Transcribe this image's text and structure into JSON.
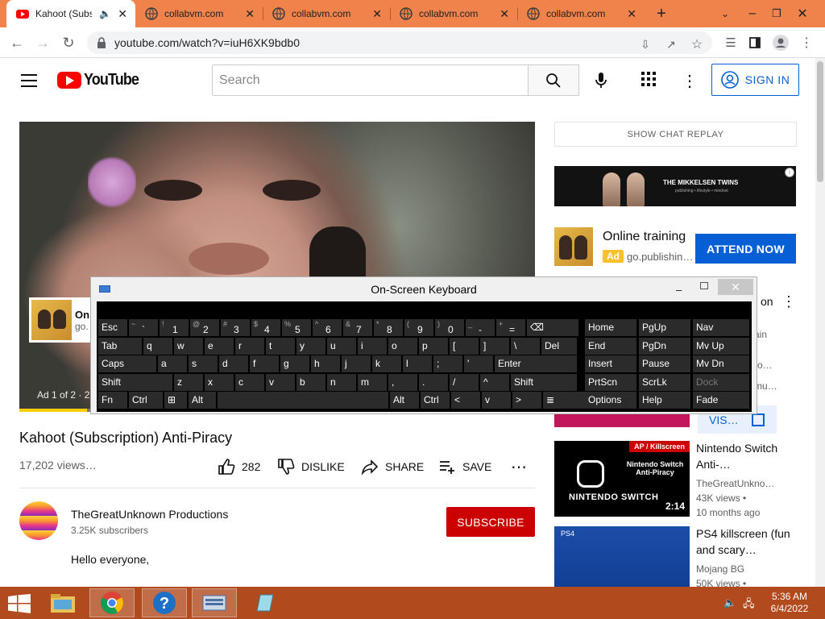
{
  "browser": {
    "tabs": [
      {
        "title": "Kahoot (Subs",
        "active": true,
        "icon": "youtube-icon",
        "audio": true
      },
      {
        "title": "collabvm.com",
        "active": false,
        "icon": "globe-icon"
      },
      {
        "title": "collabvm.com",
        "active": false,
        "icon": "globe-icon"
      },
      {
        "title": "collabvm.com",
        "active": false,
        "icon": "globe-icon"
      },
      {
        "title": "collabvm.com",
        "active": false,
        "icon": "globe-icon"
      }
    ],
    "url": "youtube.com/watch?v=iuH6XK9bdb0",
    "colors": {
      "tabstrip": "#f0834b"
    }
  },
  "youtube": {
    "logo_text": "YouTube",
    "search_placeholder": "Search",
    "signin_label": "SIGN IN",
    "video": {
      "ad_card_title": "On",
      "ad_card_url": "go.",
      "ad_label": "Ad 1 of 2 · 2"
    },
    "title": "Kahoot (Subscription) Anti-Piracy",
    "views": "17,202 views…",
    "actions": {
      "like_count": "282",
      "dislike_label": "DISLIKE",
      "share_label": "SHARE",
      "save_label": "SAVE"
    },
    "channel": {
      "name": "TheGreatUnknown Productions",
      "subscribers": "3.25K subscribers",
      "subscribe_label": "SUBSCRIBE"
    },
    "description": "Hello everyone,"
  },
  "sidebar": {
    "chat_replay_label": "SHOW CHAT REPLAY",
    "banner_ad": {
      "brand": "THE MIKKELSEN TWINS",
      "tagline": "publishing • lifestyle • mindset",
      "info": "i"
    },
    "promo": {
      "title": "Online training",
      "ad_badge": "Ad",
      "url": "go.publishin…",
      "cta": "ATTEND NOW"
    },
    "partial": {
      "on": "on",
      "ain": "ain",
      "ro": "ro…",
      "mu": "mu…",
      "visit": "VIS…"
    },
    "recommendations": [
      {
        "title": "Nintendo Switch Anti-…",
        "channel": "TheGreatUnkno…",
        "views": "43K views •",
        "age": "10 months ago",
        "duration": "2:14",
        "badge": "AP / Killscreen",
        "thumb_title": "Nintendo Switch Anti-Piracy",
        "thumb_logo": "NINTENDO SWITCH"
      },
      {
        "title": "PS4 killscreen (fun and scary…",
        "channel": "Mojang BG",
        "views": "50K views •",
        "thumb_logo": "PS4"
      }
    ]
  },
  "osk": {
    "title": "On-Screen Keyboard",
    "row1": [
      {
        "main": "Esc"
      },
      {
        "sub": "~",
        "main": "`"
      },
      {
        "sub": "!",
        "main": "1"
      },
      {
        "sub": "@",
        "main": "2"
      },
      {
        "sub": "#",
        "main": "3"
      },
      {
        "sub": "$",
        "main": "4"
      },
      {
        "sub": "%",
        "main": "5"
      },
      {
        "sub": "^",
        "main": "6"
      },
      {
        "sub": "&",
        "main": "7"
      },
      {
        "sub": "*",
        "main": "8"
      },
      {
        "sub": "(",
        "main": "9"
      },
      {
        "sub": ")",
        "main": "0"
      },
      {
        "sub": "_",
        "main": "-"
      },
      {
        "sub": "+",
        "main": "="
      },
      {
        "main": "⌫"
      }
    ],
    "row2": [
      "Tab",
      "q",
      "w",
      "e",
      "r",
      "t",
      "y",
      "u",
      "i",
      "o",
      "p",
      "[",
      "]",
      "\\",
      "Del"
    ],
    "row3": [
      "Caps",
      "a",
      "s",
      "d",
      "f",
      "g",
      "h",
      "j",
      "k",
      "l",
      ";",
      "'",
      "Enter"
    ],
    "row4": [
      "Shift",
      "z",
      "x",
      "c",
      "v",
      "b",
      "n",
      "m",
      ",",
      ".",
      "/",
      "^",
      "Shift"
    ],
    "row5": [
      "Fn",
      "Ctrl",
      "⊞",
      "Alt",
      "",
      "Alt",
      "Ctrl",
      "<",
      "v",
      ">",
      "≣"
    ],
    "nav": [
      [
        "Home",
        "PgUp",
        "Nav"
      ],
      [
        "End",
        "PgDn",
        "Mv Up"
      ],
      [
        "Insert",
        "Pause",
        "Mv Dn"
      ],
      [
        "PrtScn",
        "ScrLk",
        "Dock"
      ],
      [
        "Options",
        "Help",
        "Fade"
      ]
    ]
  },
  "taskbar": {
    "time": "5:36 AM",
    "date": "6/4/2022",
    "color": "#b14a1c"
  }
}
